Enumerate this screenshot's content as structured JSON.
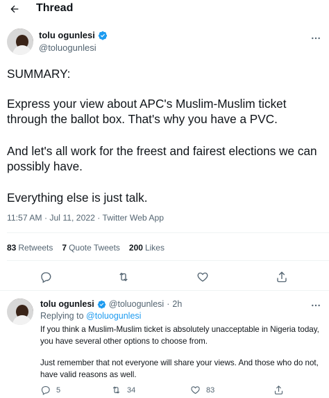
{
  "header": {
    "title": "Thread"
  },
  "main_tweet": {
    "display_name": "tolu ogunlesi",
    "handle": "@toluogunlesi",
    "paragraphs": [
      "SUMMARY:",
      "Express your view about APC's Muslim-Muslim ticket through the ballot box. That's why you have a PVC.",
      "And let's all work for the freest and fairest elections we can possibly have.",
      "Everything else is just talk."
    ],
    "timestamp": "11:57 AM · Jul 11, 2022",
    "separator": " · ",
    "source": "Twitter Web App",
    "stats": {
      "retweets_count": "83",
      "retweets_label": "Retweets",
      "quotes_count": "7",
      "quotes_label": "Quote Tweets",
      "likes_count": "200",
      "likes_label": "Likes"
    }
  },
  "reply_tweet": {
    "display_name": "tolu ogunlesi",
    "handle": "@toluogunlesi",
    "time_ago": "2h",
    "dot": "·",
    "replying_prefix": "Replying to",
    "replying_to": "@toluogunlesi",
    "paragraphs": [
      "If you think a Muslim-Muslim ticket is absolutely unacceptable in Nigeria today, you have several other options to choose from.",
      "Just remember that not everyone will share your views. And those who do not, have valid reasons as well."
    ],
    "reply_count": "5",
    "retweet_count": "34",
    "like_count": "83"
  },
  "icons": {
    "back": "arrow-left-icon",
    "more": "more-horizontal-icon",
    "verified": "verified-badge-icon",
    "reply": "reply-icon",
    "retweet": "retweet-icon",
    "like": "heart-icon",
    "share": "share-icon"
  },
  "colors": {
    "accent": "#1d9bf0",
    "secondary_text": "#536471",
    "divider": "#eff3f4"
  }
}
